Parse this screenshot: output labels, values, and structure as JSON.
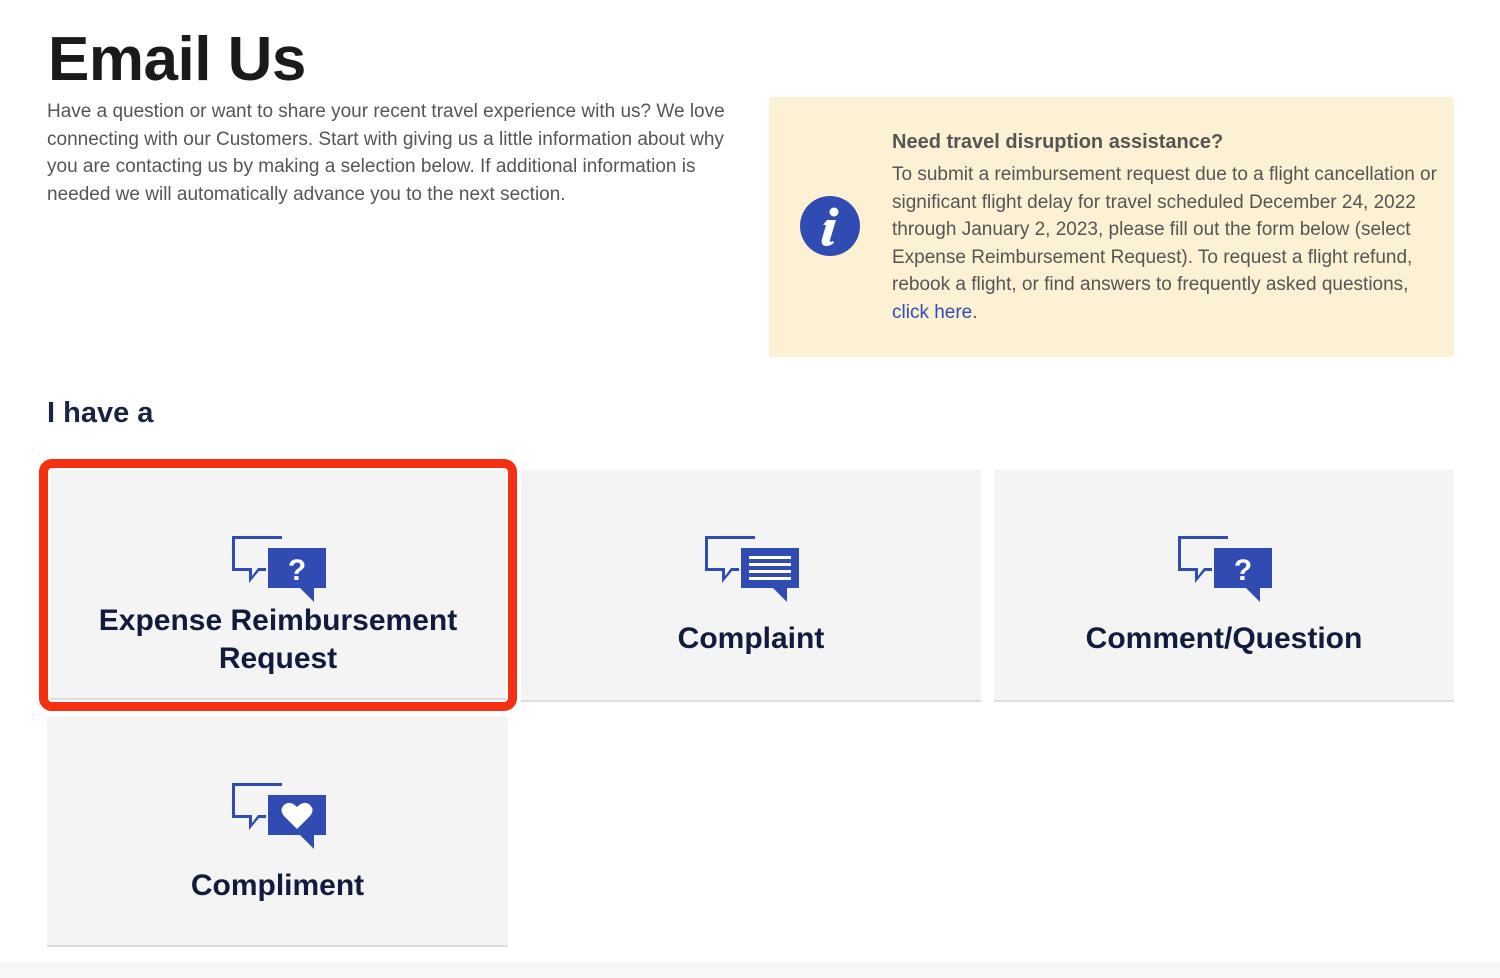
{
  "page": {
    "title": "Email Us",
    "intro": "Have a question or want to share your recent travel experience with us? We love connecting with our Customers. Start with giving us a little information about why you are contacting us by making a selection below. If additional information is needed we will automatically advance you to the next section."
  },
  "notice": {
    "icon": "info-icon",
    "title": "Need travel disruption assistance?",
    "body": "To submit a reimbursement request due to a flight cancellation or significant flight delay for travel scheduled December 24, 2022 through January 2, 2023, please fill out the form below (select Expense Reimbursement Request). To request a flight refund, rebook a flight, or find answers to frequently asked questions,",
    "link_text": "click here",
    "link_suffix": "."
  },
  "section": {
    "heading": "I have a"
  },
  "options": [
    {
      "label_line1": "Expense Reimbursement",
      "label_line2": "Request",
      "icon": "chat-question-icon",
      "selected": true
    },
    {
      "label": "Complaint",
      "icon": "chat-document-icon",
      "selected": false
    },
    {
      "label": "Comment/Question",
      "icon": "chat-question-icon",
      "selected": false
    },
    {
      "label": "Compliment",
      "icon": "chat-heart-icon",
      "selected": false
    }
  ],
  "colors": {
    "brand_blue": "#304cb2",
    "selection_outline": "#f52f12",
    "notice_background": "#fdf1d4",
    "card_background": "#f4f4f4",
    "heading_navy": "#111b3d"
  }
}
